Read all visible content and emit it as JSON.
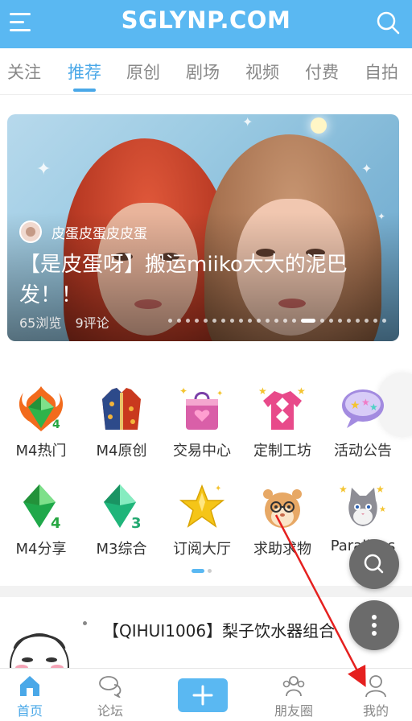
{
  "header": {
    "logo": "SGLYNP.COM",
    "menu_icon": "menu-icon",
    "search_icon": "search-icon",
    "bg_color": "#5ab8f2"
  },
  "tabs": [
    {
      "label": "关注",
      "active": false
    },
    {
      "label": "推荐",
      "active": true
    },
    {
      "label": "原创",
      "active": false
    },
    {
      "label": "剧场",
      "active": false
    },
    {
      "label": "视频",
      "active": false
    },
    {
      "label": "付费",
      "active": false
    },
    {
      "label": "自拍",
      "active": false
    }
  ],
  "banner": {
    "author": "皮蛋皮蛋皮皮蛋",
    "title": "【是皮蛋呀】搬运miiko大大的泥巴发！！",
    "views": "65浏览",
    "comments": "9评论",
    "slide_count": 24,
    "active_slide": 15
  },
  "grid": [
    {
      "label": "M4热门",
      "icon": "fire-gem-icon"
    },
    {
      "label": "M4原创",
      "icon": "jacket-icon"
    },
    {
      "label": "交易中心",
      "icon": "shopping-bag-icon"
    },
    {
      "label": "定制工坊",
      "icon": "sweater-icon"
    },
    {
      "label": "活动公告",
      "icon": "speech-bubble-stars-icon"
    },
    {
      "label": "M4分享",
      "icon": "green-gem-4-icon"
    },
    {
      "label": "M3综合",
      "icon": "green-gem-3-icon"
    },
    {
      "label": "订阅大厅",
      "icon": "gold-star-icon"
    },
    {
      "label": "求助求物",
      "icon": "hamster-icon"
    },
    {
      "label": "Paralives",
      "icon": "cat-stars-icon"
    }
  ],
  "grid_pages": {
    "total": 2,
    "active": 1
  },
  "post": {
    "title": "【QIHUI1006】梨子饮水器组合"
  },
  "floating": {
    "search_icon": "search-icon",
    "more_icon": "more-vertical-icon"
  },
  "bottom_nav": [
    {
      "label": "首页",
      "icon": "home-icon",
      "active": true
    },
    {
      "label": "论坛",
      "icon": "chat-icon",
      "active": false
    },
    {
      "label": "",
      "icon": "plus-icon",
      "active": false
    },
    {
      "label": "朋友圈",
      "icon": "friends-icon",
      "active": false
    },
    {
      "label": "我的",
      "icon": "user-icon",
      "active": false
    }
  ],
  "colors": {
    "accent": "#4aa8e8",
    "annotation_arrow": "#e5201f"
  }
}
